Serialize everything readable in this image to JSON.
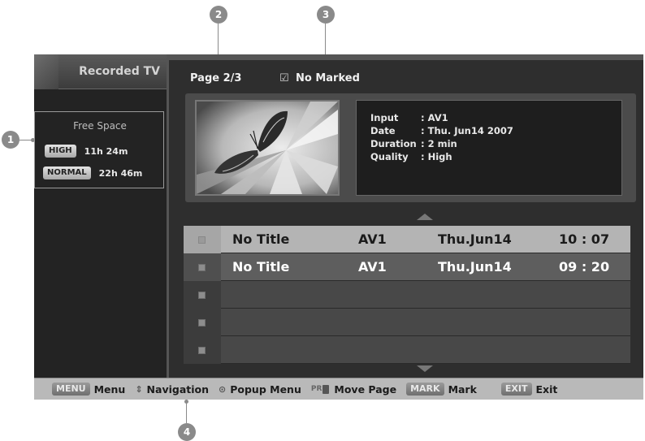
{
  "sidebar": {
    "title": "Recorded TV",
    "free_space": {
      "title": "Free Space",
      "rows": [
        {
          "quality": "HIGH",
          "time": "11h 24m"
        },
        {
          "quality": "NORMAL",
          "time": "22h 46m"
        }
      ]
    }
  },
  "header": {
    "page": "Page 2/3",
    "marked_icon": "☑",
    "marked_label": "No Marked"
  },
  "info": {
    "input_key": "Input",
    "input_val": ": AV1",
    "date_key": "Date",
    "date_val": ": Thu. Jun14 2007",
    "duration_key": "Duration",
    "duration_val": ": 2 min",
    "quality_key": "Quality",
    "quality_val": ": High",
    "thumbnail_icon": "butterfly-thumbnail"
  },
  "list": {
    "rows": [
      {
        "title": "No Title",
        "input": "AV1",
        "date": "Thu.Jun14",
        "time": "10 : 07"
      },
      {
        "title": "No Title",
        "input": "AV1",
        "date": "Thu.Jun14",
        "time": "09 : 20"
      },
      {
        "title": "",
        "input": "",
        "date": "",
        "time": ""
      },
      {
        "title": "",
        "input": "",
        "date": "",
        "time": ""
      },
      {
        "title": "",
        "input": "",
        "date": "",
        "time": ""
      }
    ]
  },
  "bottom_bar": {
    "menu_key": "MENU",
    "menu_label": "Menu",
    "nav_glyph": "⇕",
    "nav_label": "Navigation",
    "popup_glyph": "⊙",
    "popup_label": "Popup Menu",
    "pr_glyph": "PR",
    "move_label": "Move Page",
    "mark_key": "MARK",
    "mark_label": "Mark",
    "exit_key": "EXIT",
    "exit_label": "Exit"
  },
  "callouts": {
    "c1": "1",
    "c2": "2",
    "c3": "3",
    "c4": "4"
  },
  "colors": {
    "background": "#1c1c1c",
    "selected_row": "#b4b4b4",
    "bottom_bar": "#b9b9b9",
    "callout": "#8a8a8a"
  }
}
